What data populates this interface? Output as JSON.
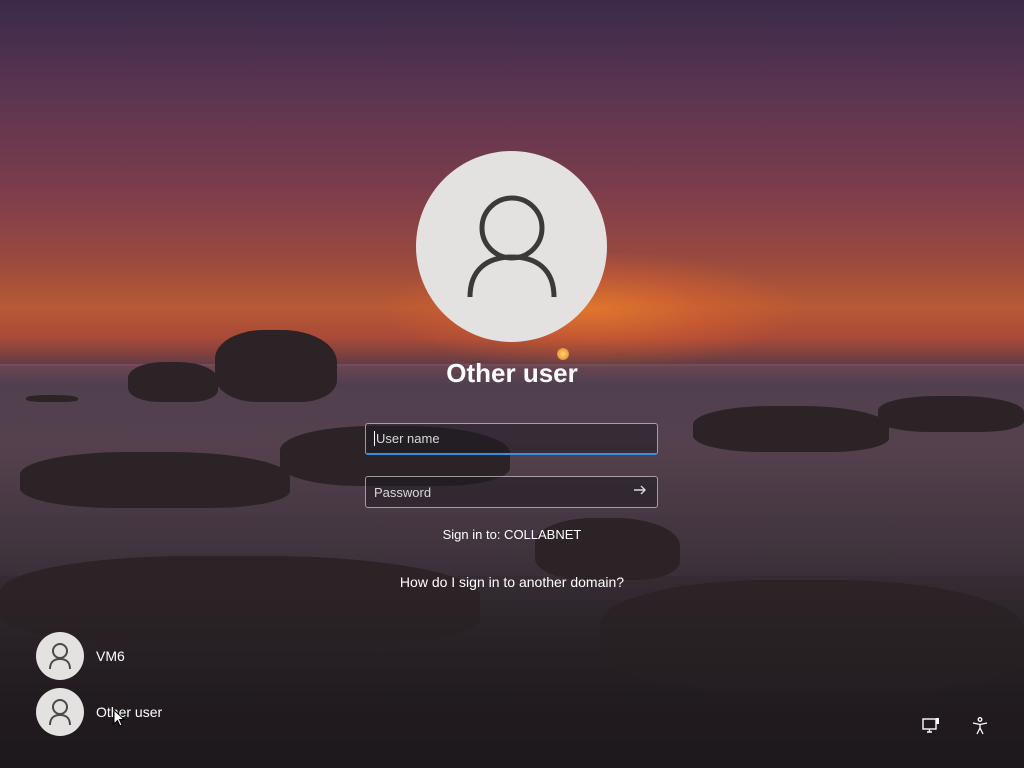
{
  "screen": {
    "type": "windows-lock-screen"
  },
  "selected_user": {
    "title": "Other user",
    "avatar_icon": "person-icon"
  },
  "form": {
    "username": {
      "placeholder": "User name",
      "value": ""
    },
    "password": {
      "placeholder": "Password",
      "value": "",
      "submit_icon": "arrow-right-icon"
    }
  },
  "domain": {
    "sign_in_to": "Sign in to: COLLABNET",
    "help_link": "How do I sign in to another domain?"
  },
  "user_list": [
    {
      "label": "VM6",
      "icon": "person-icon"
    },
    {
      "label": "Other user",
      "icon": "person-icon"
    }
  ],
  "corner_buttons": {
    "network": "network-icon",
    "accessibility": "accessibility-icon"
  },
  "colors": {
    "focus_accent": "#3a8fe0",
    "avatar_bg": "#e4e1e1",
    "text": "#ffffff"
  }
}
